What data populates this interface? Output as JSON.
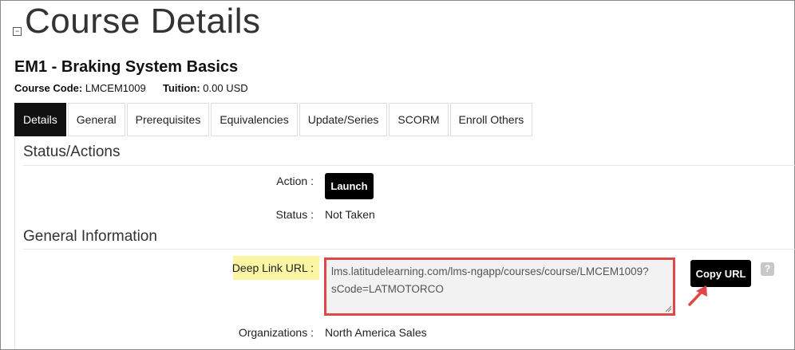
{
  "header": {
    "title": "Course Details",
    "collapse_icon": "minus-square-icon"
  },
  "course": {
    "name": "EM1 - Braking System Basics",
    "code_label": "Course Code:",
    "code_value": "LMCEM1009",
    "tuition_label": "Tuition:",
    "tuition_value": "0.00 USD"
  },
  "tabs": [
    {
      "label": "Details",
      "active": true
    },
    {
      "label": "General"
    },
    {
      "label": "Prerequisites"
    },
    {
      "label": "Equivalencies"
    },
    {
      "label": "Update/Series"
    },
    {
      "label": "SCORM"
    },
    {
      "label": "Enroll Others"
    }
  ],
  "status_actions": {
    "title": "Status/Actions",
    "action_label": "Action :",
    "launch_label": "Launch",
    "status_label": "Status :",
    "status_value": "Not Taken"
  },
  "general_info": {
    "title": "General Information",
    "deep_link_label": "Deep Link URL :",
    "deep_link_line1": "lms.latitudelearning.com/lms-ngapp/courses/course/LMCEM1009?",
    "deep_link_line2": "sCode=LATMOTORCO",
    "copy_label": "Copy URL",
    "help_icon": "?",
    "org_label": "Organizations :",
    "org_value": "North America Sales"
  },
  "colors": {
    "accent_black": "#000000",
    "highlight_box": "#e04747",
    "highlight_label": "#fbf6a4"
  }
}
